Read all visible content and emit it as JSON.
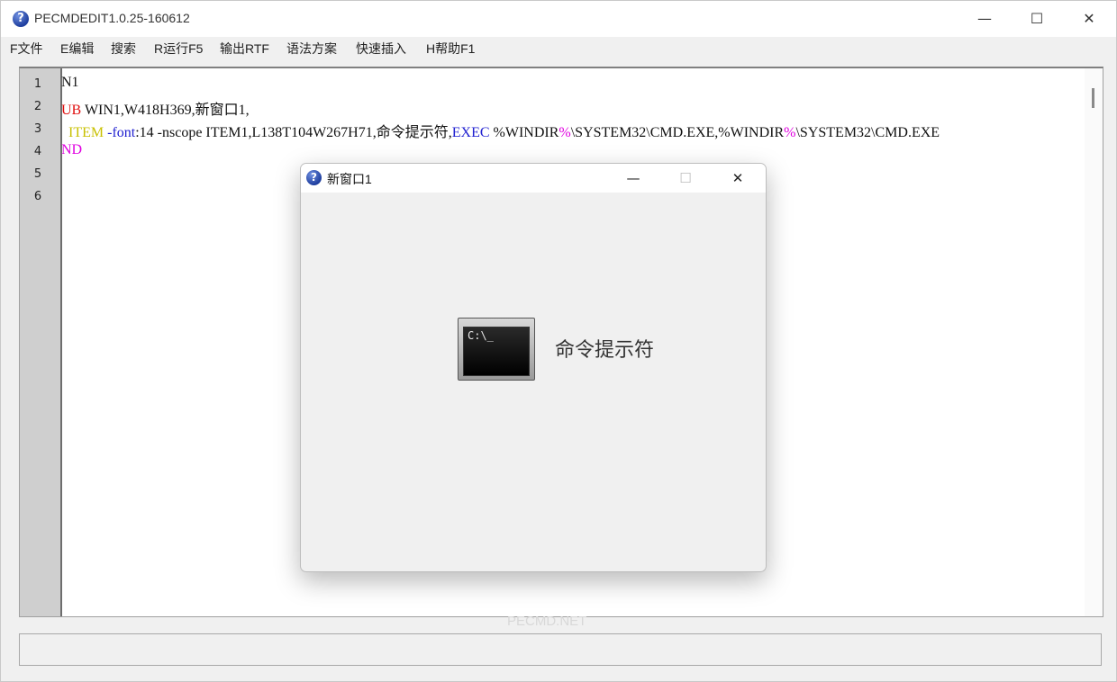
{
  "app": {
    "title": "PECMDEDIT1.0.25-160612",
    "icon": "question-icon",
    "window_controls": [
      "minimize-icon",
      "maximize-icon",
      "close-icon"
    ]
  },
  "menu": {
    "items": [
      {
        "label": "F文件"
      },
      {
        "label": "E编辑"
      },
      {
        "label": "搜索"
      },
      {
        "label": "R运行F5"
      },
      {
        "label": "输出RTF"
      },
      {
        "label": "语法方案"
      },
      {
        "label": "快速插入"
      },
      {
        "label": "H帮助F1"
      }
    ]
  },
  "editor": {
    "line_numbers": [
      "1",
      "2",
      "3",
      "4",
      "5",
      "6"
    ],
    "lines": [
      [
        {
          "text": "N1",
          "color": "black"
        }
      ],
      [
        {
          "text": "UB",
          "color": "red"
        },
        {
          "text": " WIN1,W418H369,新窗口1,",
          "color": "black"
        }
      ],
      [
        {
          "text": "  ",
          "color": "black"
        },
        {
          "text": "ITEM",
          "color": "yellow"
        },
        {
          "text": " -font",
          "color": "blue"
        },
        {
          "text": ":14 -nscope ITEM1,L138T104W267H71,命令提示符,",
          "color": "black"
        },
        {
          "text": "EXEC",
          "color": "blue"
        },
        {
          "text": " %WINDIR",
          "color": "black"
        },
        {
          "text": "%",
          "color": "magenta"
        },
        {
          "text": "\\SYSTEM32\\CMD.EXE,%WINDIR",
          "color": "black"
        },
        {
          "text": "%",
          "color": "magenta"
        },
        {
          "text": "\\SYSTEM32\\CMD.EXE",
          "color": "black"
        }
      ],
      [
        {
          "text": "ND",
          "color": "magenta"
        }
      ],
      [],
      []
    ]
  },
  "watermark": "PECMD.NET",
  "child_window": {
    "title": "新窗口1",
    "icon": "question-icon",
    "item": {
      "label": "命令提示符",
      "icon": "cmd-icon",
      "prompt_text": "C:\\_"
    }
  },
  "colors": {
    "red": "#e01010",
    "yellow": "#c8c000",
    "blue": "#2020d0",
    "magenta": "#e000e0",
    "black": "#111111",
    "gutter": "#cfcfcf"
  }
}
